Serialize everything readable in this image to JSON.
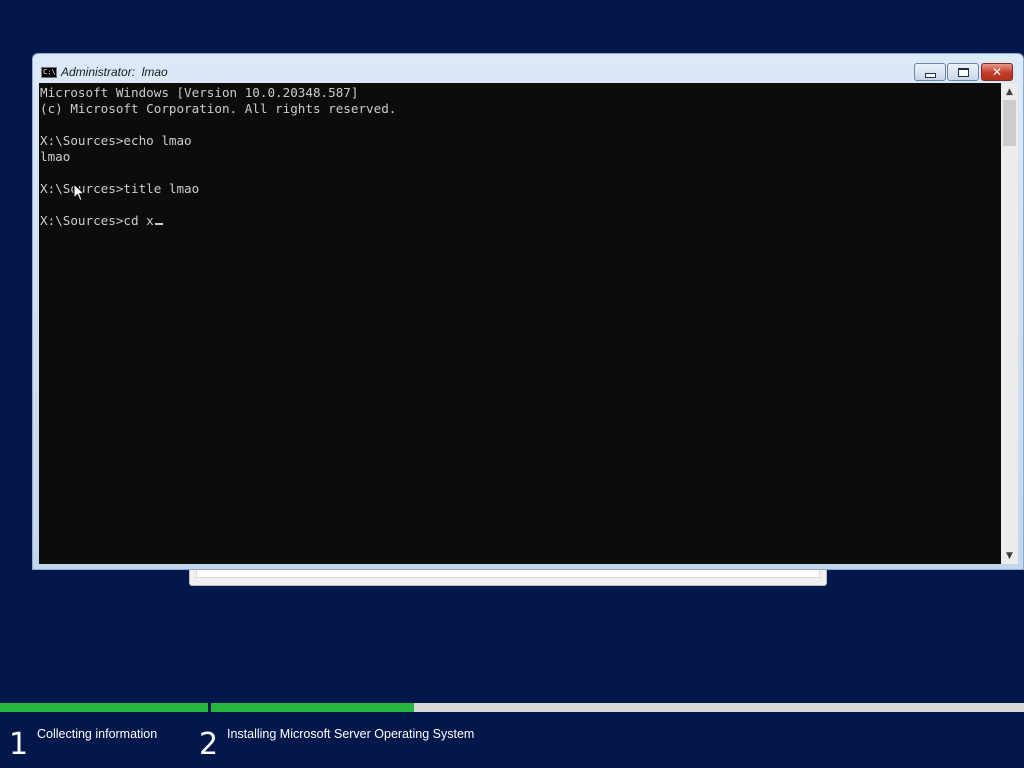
{
  "colors": {
    "desktop_bg": "#03184a",
    "console_bg": "#0c0c0c",
    "console_fg": "#cccccc",
    "progress_fill": "#26b640",
    "progress_track": "#d8d8d8"
  },
  "window": {
    "icon_text": "C:\\",
    "title": "Administrator:  lmao",
    "minimize_icon": "minimize-icon",
    "maximize_icon": "restore-icon",
    "close_label": "✕"
  },
  "console": {
    "lines": [
      "Microsoft Windows [Version 10.0.20348.587]",
      "(c) Microsoft Corporation. All rights reserved.",
      "",
      "X:\\Sources>echo lmao",
      "lmao",
      "",
      "X:\\Sources>title lmao",
      "",
      "X:\\Sources>cd x"
    ]
  },
  "scrollbar": {
    "up_arrow": "▲",
    "down_arrow": "▼"
  },
  "setup_progress": {
    "steps": [
      {
        "number": "1",
        "label": "Collecting information",
        "progress": 1.0
      },
      {
        "number": "2",
        "label": "Installing Microsoft Server Operating System",
        "progress": 0.25
      }
    ]
  }
}
